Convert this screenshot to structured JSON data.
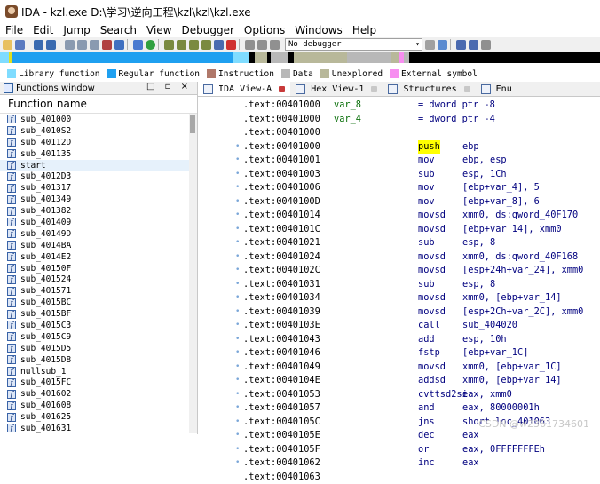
{
  "window": {
    "title": "IDA - kzl.exe D:\\学习\\逆向工程\\kzl\\kzl\\kzl.exe"
  },
  "menu": [
    "File",
    "Edit",
    "Jump",
    "Search",
    "View",
    "Debugger",
    "Options",
    "Windows",
    "Help"
  ],
  "toolbar": {
    "debugger_select": "No debugger"
  },
  "legend": [
    {
      "label": "Library function",
      "color": "#7fdcff"
    },
    {
      "label": "Regular function",
      "color": "#1fa0f0"
    },
    {
      "label": "Instruction",
      "color": "#b0786a"
    },
    {
      "label": "Data",
      "color": "#b8b8b8"
    },
    {
      "label": "Unexplored",
      "color": "#b8b89a"
    },
    {
      "label": "External symbol",
      "color": "#f78ef0"
    }
  ],
  "functions_window": {
    "title": "Functions window",
    "column": "Function name",
    "items": [
      "sub_401000",
      "sub_4010S2",
      "sub_40112D",
      "sub_401135",
      "start",
      "sub_4012D3",
      "sub_401317",
      "sub_401349",
      "sub_401382",
      "sub_401409",
      "sub_40149D",
      "sub_4014BA",
      "sub_4014E2",
      "sub_40150F",
      "sub_401524",
      "sub_401571",
      "sub_4015BC",
      "sub_4015BF",
      "sub_4015C3",
      "sub_4015C9",
      "sub_4015D5",
      "sub_4015D8",
      "nullsub_1",
      "sub_4015FC",
      "sub_401602",
      "sub_401608",
      "sub_401625",
      "sub_401631"
    ],
    "selected_index": 4
  },
  "tabs": [
    {
      "label": "IDA View-A",
      "active": true
    },
    {
      "label": "Hex View-1",
      "active": false
    },
    {
      "label": "Structures",
      "active": false
    },
    {
      "label": "Enu",
      "active": false
    }
  ],
  "disasm": [
    {
      "addr": ".text:00401000",
      "var": "var_8",
      "decl": "= dword ptr -8",
      "dot": false
    },
    {
      "addr": ".text:00401000",
      "var": "var_4",
      "decl": "= dword ptr -4",
      "dot": false
    },
    {
      "addr": ".text:00401000",
      "dot": false
    },
    {
      "addr": ".text:00401000",
      "mnem": "push",
      "ops": "ebp",
      "hl": true,
      "dot": true
    },
    {
      "addr": ".text:00401001",
      "mnem": "mov",
      "ops": "ebp, esp",
      "dot": true
    },
    {
      "addr": ".text:00401003",
      "mnem": "sub",
      "ops": "esp, 1Ch",
      "dot": true
    },
    {
      "addr": ".text:00401006",
      "mnem": "mov",
      "ops": "[ebp+var_4], 5",
      "dot": true
    },
    {
      "addr": ".text:0040100D",
      "mnem": "mov",
      "ops": "[ebp+var_8], 6",
      "dot": true
    },
    {
      "addr": ".text:00401014",
      "mnem": "movsd",
      "ops": "xmm0, ds:qword_40F170",
      "dot": true
    },
    {
      "addr": ".text:0040101C",
      "mnem": "movsd",
      "ops": "[ebp+var_14], xmm0",
      "dot": true
    },
    {
      "addr": ".text:00401021",
      "mnem": "sub",
      "ops": "esp, 8",
      "dot": true
    },
    {
      "addr": ".text:00401024",
      "mnem": "movsd",
      "ops": "xmm0, ds:qword_40F168",
      "dot": true
    },
    {
      "addr": ".text:0040102C",
      "mnem": "movsd",
      "ops": "[esp+24h+var_24], xmm0",
      "dot": true
    },
    {
      "addr": ".text:00401031",
      "mnem": "sub",
      "ops": "esp, 8",
      "dot": true
    },
    {
      "addr": ".text:00401034",
      "mnem": "movsd",
      "ops": "xmm0, [ebp+var_14]",
      "dot": true
    },
    {
      "addr": ".text:00401039",
      "mnem": "movsd",
      "ops": "[esp+2Ch+var_2C], xmm0",
      "dot": true
    },
    {
      "addr": ".text:0040103E",
      "mnem": "call",
      "ops": "sub_404020",
      "dot": true
    },
    {
      "addr": ".text:00401043",
      "mnem": "add",
      "ops": "esp, 10h",
      "dot": true
    },
    {
      "addr": ".text:00401046",
      "mnem": "fstp",
      "ops": "[ebp+var_1C]",
      "dot": true
    },
    {
      "addr": ".text:00401049",
      "mnem": "movsd",
      "ops": "xmm0, [ebp+var_1C]",
      "dot": true
    },
    {
      "addr": ".text:0040104E",
      "mnem": "addsd",
      "ops": "xmm0, [ebp+var_14]",
      "dot": true
    },
    {
      "addr": ".text:00401053",
      "mnem": "cvttsd2si",
      "ops": "eax, xmm0",
      "dot": true
    },
    {
      "addr": ".text:00401057",
      "mnem": "and",
      "ops": "eax, 80000001h",
      "dot": true
    },
    {
      "addr": ".text:0040105C",
      "mnem": "jns",
      "ops": "short loc_401063",
      "dot": true
    },
    {
      "addr": ".text:0040105E",
      "mnem": "dec",
      "ops": "eax",
      "dot": true
    },
    {
      "addr": ".text:0040105F",
      "mnem": "or",
      "ops": "eax, 0FFFFFFFEh",
      "dot": true
    },
    {
      "addr": ".text:00401062",
      "mnem": "inc",
      "ops": "eax",
      "dot": true
    },
    {
      "addr": ".text:00401063",
      "dot": false
    }
  ],
  "watermark": "CSDN @w2361734601"
}
